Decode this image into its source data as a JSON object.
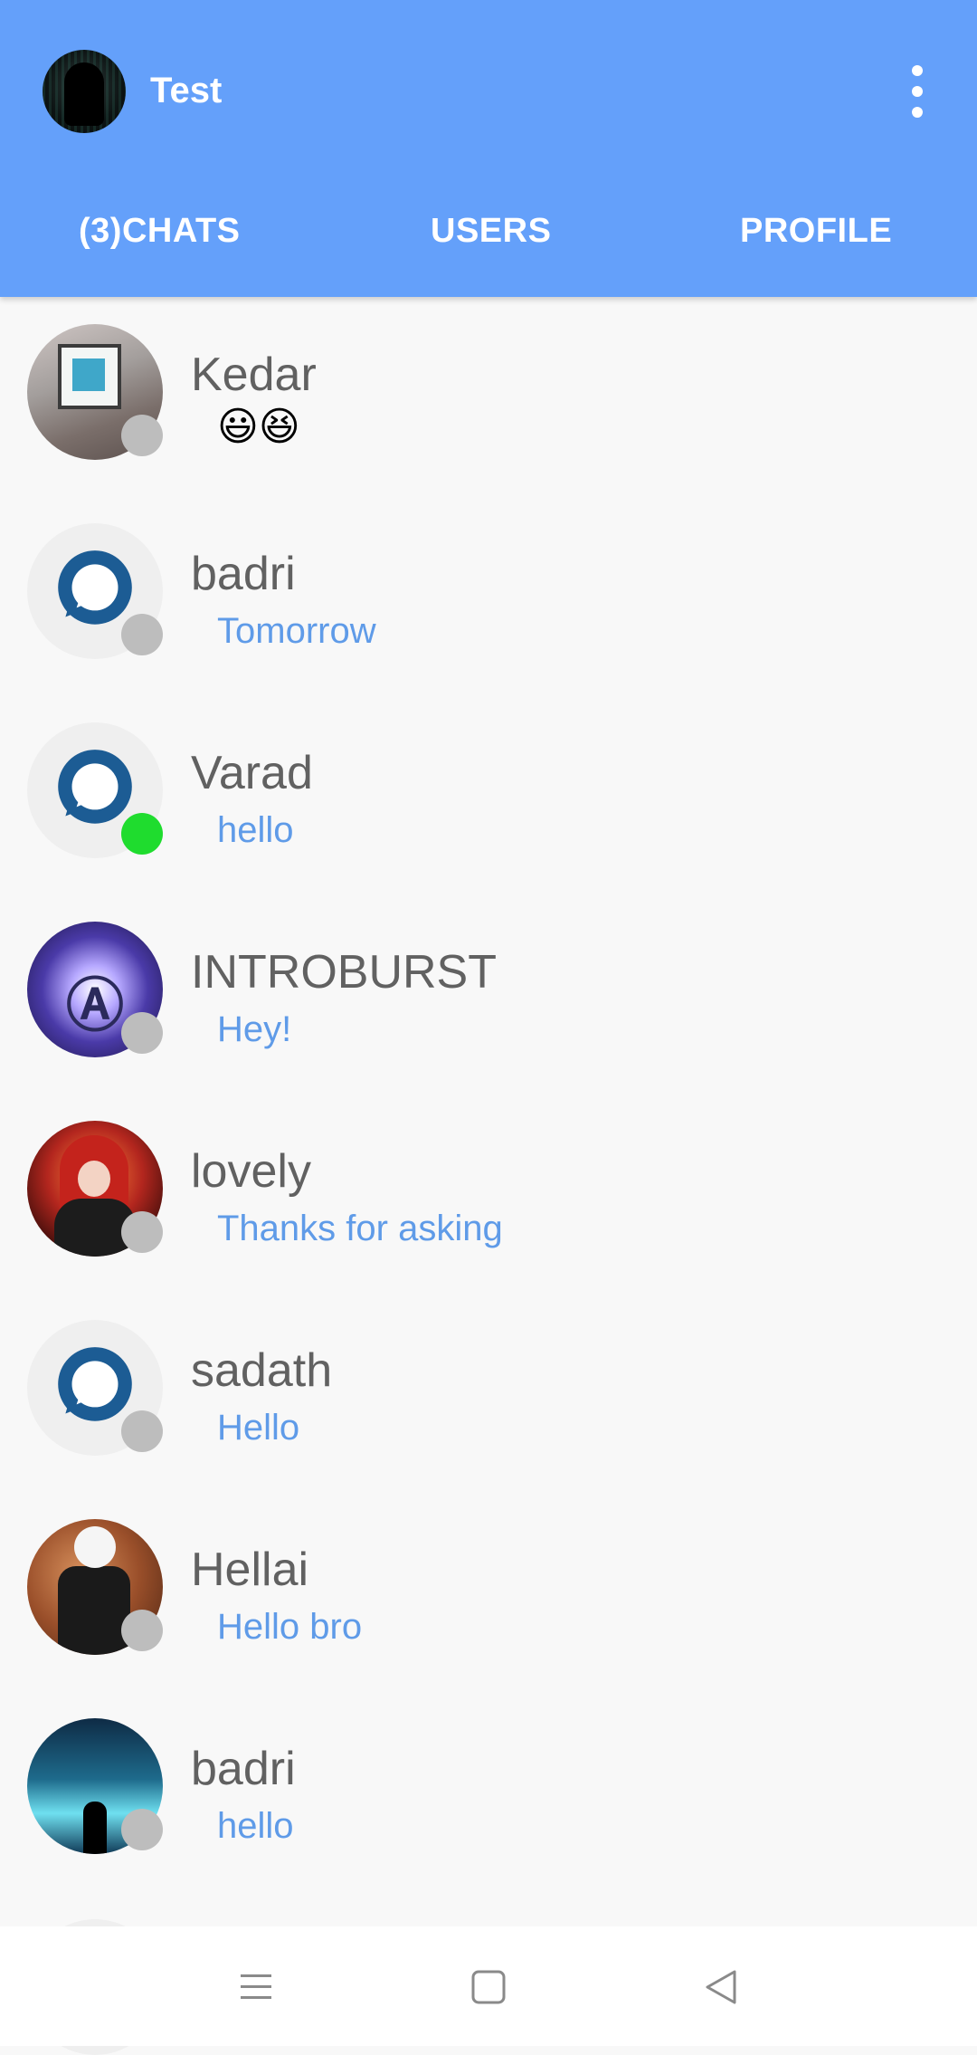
{
  "header": {
    "title": "Test",
    "tabs": [
      {
        "label": "(3)CHATS"
      },
      {
        "label": "USERS"
      },
      {
        "label": "PROFILE"
      }
    ]
  },
  "chats": [
    {
      "name": "Kedar",
      "message": "😃😆",
      "status": "offline",
      "avatar": "photo"
    },
    {
      "name": "badri",
      "message": "Tomorrow",
      "status": "offline",
      "avatar": "default-chat-icon"
    },
    {
      "name": "Varad",
      "message": "hello",
      "status": "online",
      "avatar": "default-chat-icon"
    },
    {
      "name": "INTROBURST",
      "message": "Hey!",
      "status": "offline",
      "avatar": "photo"
    },
    {
      "name": "lovely",
      "message": "Thanks for asking",
      "status": "offline",
      "avatar": "photo"
    },
    {
      "name": "sadath",
      "message": "Hello",
      "status": "offline",
      "avatar": "default-chat-icon"
    },
    {
      "name": "Hellai",
      "message": "Hello bro",
      "status": "offline",
      "avatar": "photo"
    },
    {
      "name": "badri",
      "message": "hello",
      "status": "offline",
      "avatar": "photo"
    }
  ],
  "colors": {
    "appbar": "#64a0fa",
    "message_text": "#5f9be8",
    "name_text": "#616161",
    "online": "#1fdc2e",
    "offline": "#bdbdbd",
    "chat_icon": "#1c5c94"
  },
  "navbar": {
    "icons": [
      "menu-icon",
      "home-square-icon",
      "back-triangle-icon"
    ]
  }
}
